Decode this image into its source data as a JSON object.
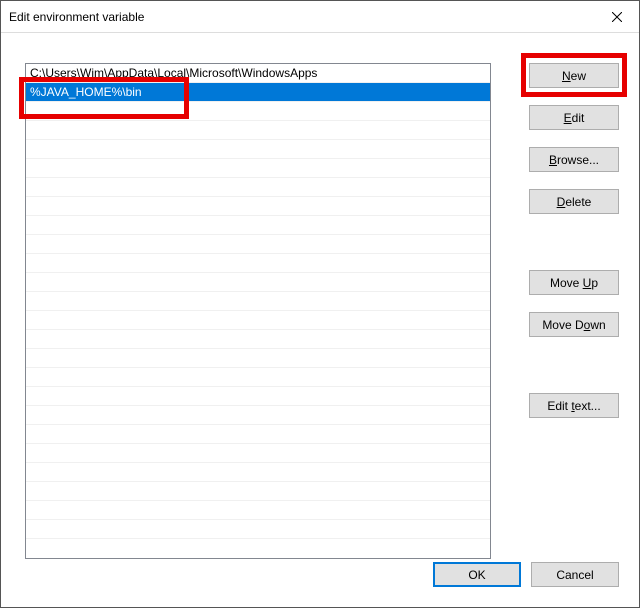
{
  "window": {
    "title": "Edit environment variable"
  },
  "list": {
    "items": [
      {
        "text": "C:\\Users\\Wim\\AppData\\Local\\Microsoft\\WindowsApps",
        "selected": false
      },
      {
        "text": "%JAVA_HOME%\\bin",
        "selected": true
      }
    ]
  },
  "buttons": {
    "new": "New",
    "edit": "Edit",
    "browse": "Browse...",
    "delete": "Delete",
    "moveup": "Move Up",
    "movedown": "Move Down",
    "edittext": "Edit text...",
    "ok": "OK",
    "cancel": "Cancel"
  }
}
